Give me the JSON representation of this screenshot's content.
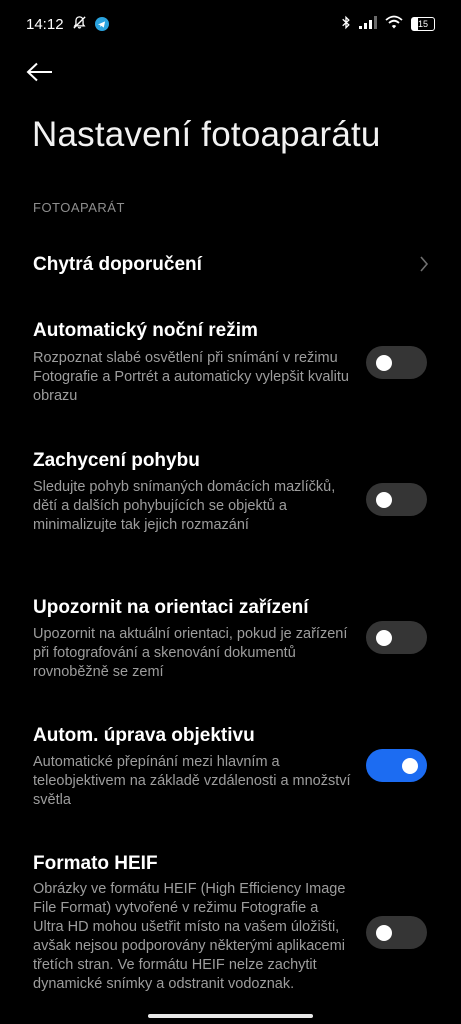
{
  "status_bar": {
    "time": "14:12",
    "battery_level": "15",
    "icons": [
      "bell-off-icon",
      "telegram-icon",
      "bluetooth-icon",
      "signal-icon",
      "wifi-icon",
      "battery-icon"
    ]
  },
  "header": {
    "title": "Nastavení fotoaparátu"
  },
  "section": {
    "label": "FOTOAPARÁT"
  },
  "items": [
    {
      "title": "Chytrá doporučení",
      "type": "link"
    },
    {
      "title": "Automatický noční režim",
      "description": "Rozpoznat slabé osvětlení při snímání v režimu Fotografie a Portrét a automaticky vylepšit kvalitu obrazu",
      "enabled": false
    },
    {
      "title": "Zachycení pohybu",
      "description": "Sledujte pohyb snímaných domácích mazlíčků, dětí a dalších pohybujících se objektů a minimalizujte tak jejich rozmazání",
      "enabled": false
    },
    {
      "title": "Upozornit na orientaci zařízení",
      "description": "Upozornit na aktuální orientaci, pokud je zařízení při fotografování a skenování dokumentů rovnoběžně se zemí",
      "enabled": false
    },
    {
      "title": "Autom. úprava objektivu",
      "description": "Automatické přepínání mezi hlavním a teleobjektivem na základě vzdálenosti a množství světla",
      "enabled": true
    },
    {
      "title": "Formato HEIF",
      "description": "Obrázky ve formátu HEIF (High Efficiency Image File Format) vytvořené v režimu Fotografie a Ultra HD mohou ušetřit místo na vašem úložišti, avšak nejsou podporovány některými aplikacemi třetích stran. Ve formátu HEIF nelze zachytit dynamické snímky a odstranit vodoznak.",
      "enabled": false
    }
  ],
  "colors": {
    "background": "#000000",
    "toggle_on": "#1c6cf2",
    "toggle_off": "#353535",
    "description_text": "#9d9d9d"
  }
}
